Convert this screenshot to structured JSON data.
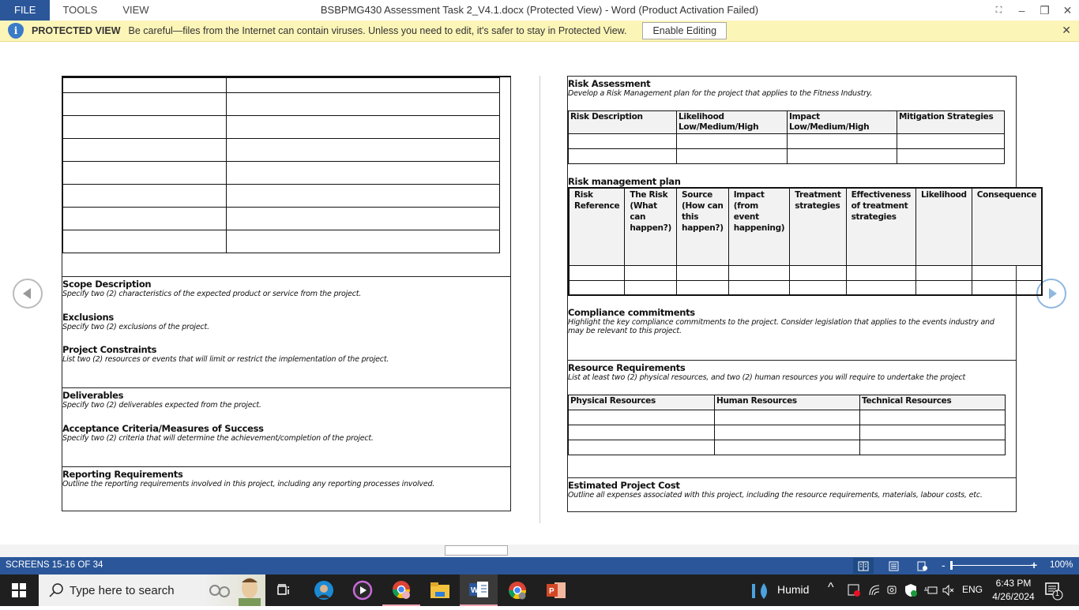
{
  "window": {
    "title": "BSBPMG430 Assessment Task 2_V4.1.docx (Protected View) - Word (Product Activation Failed)",
    "menu": [
      "FILE",
      "TOOLS",
      "VIEW"
    ],
    "controls": {
      "fullscreen": "⛶",
      "minimize": "–",
      "restore": "❐",
      "close": "✕"
    }
  },
  "protected_bar": {
    "label": "PROTECTED VIEW",
    "message": "Be careful—files from the Internet can contain viruses. Unless you need to edit, it's safer to stay in Protected View.",
    "enable_button": "Enable Editing",
    "close": "✕",
    "icon": "i"
  },
  "left_page": {
    "top_table_rows": 8,
    "sections": [
      {
        "title": "Scope Description",
        "subtitle": "Specify two (2) characteristics of the expected product or service from the project."
      },
      {
        "title": "Exclusions",
        "subtitle": "Specify two (2) exclusions of the project."
      },
      {
        "title": "Project Constraints",
        "subtitle": "List two (2) resources or events that will limit or restrict the implementation of the project."
      },
      {
        "title": "Deliverables",
        "subtitle": "Specify two (2) deliverables expected from the project."
      },
      {
        "title": "Acceptance Criteria/Measures of Success",
        "subtitle": "Specify two (2) criteria that will determine the achievement/completion of the project."
      },
      {
        "title": "Reporting Requirements",
        "subtitle": "Outline the reporting requirements involved in this project, including any reporting processes involved."
      }
    ]
  },
  "right_page": {
    "risk_assessment": {
      "title": "Risk Assessment",
      "subtitle": "Develop a Risk Management plan for the project that applies to the Fitness Industry.",
      "headers": [
        "Risk Description",
        "Likelihood",
        "Low/Medium/High",
        "Impact",
        "Low/Medium/High",
        "Mitigation Strategies"
      ]
    },
    "risk_plan": {
      "title": "Risk management plan",
      "headers": [
        [
          "Risk",
          "Reference"
        ],
        [
          "The Risk",
          "(What can",
          "happen?)"
        ],
        [
          "Source",
          "(How can",
          "this",
          "happen?)"
        ],
        [
          "Impact",
          "(from",
          "event",
          "happening)"
        ],
        [
          "Treatment",
          "strategies"
        ],
        [
          "Effectiveness",
          "of treatment",
          "strategies"
        ],
        [
          "Likelihood"
        ],
        [
          "Consequence"
        ]
      ]
    },
    "compliance": {
      "title": "Compliance commitments",
      "subtitle_1": "Highlight the key compliance commitments to the project. Consider legislation that applies to the events industry and",
      "subtitle_2": "may be relevant to this project."
    },
    "resources": {
      "title": "Resource Requirements",
      "subtitle": "List at least two (2) physical resources, and two (2) human resources you will require to undertake the project",
      "headers": [
        "Physical Resources",
        "Human Resources",
        "Technical Resources"
      ]
    },
    "cost": {
      "title": "Estimated Project Cost",
      "subtitle": "Outline all expenses associated with this project, including the resource requirements, materials, labour costs, etc."
    }
  },
  "status_bar": {
    "page_info": "SCREENS 15-16 OF 34",
    "zoom": "100%",
    "zoom_minus": "-",
    "zoom_plus": "+",
    "zoom_level_percent": 100
  },
  "taskbar": {
    "search_placeholder": "Type here to search",
    "weather": "Humid",
    "language": "ENG",
    "time": "6:43 PM",
    "date": "4/26/2024",
    "notification_count": "1",
    "tray_arrow": "^"
  }
}
